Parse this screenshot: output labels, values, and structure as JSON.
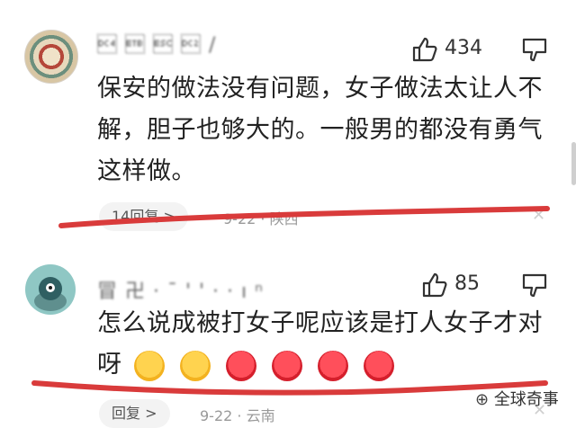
{
  "comments": [
    {
      "username": "\u0014 \u0017 \u001b \u0012 /",
      "likes": "434",
      "text_lines": [
        "保安的做法没有问题，女子做法太让人不",
        "解，胆子也够大的。一般男的都没有勇气",
        "这样做。"
      ],
      "replies": "14回复 >",
      "meta": "9-22 · 陕西"
    },
    {
      "username": "冒 卍 · ¯ ' ' ·  ·   ı ⁿ",
      "likes": "85",
      "text_lines": [
        "怎么说成被打女子呢应该是打人女子才对",
        "呀"
      ],
      "replies": "回复 >",
      "meta": "9-22 · 云南"
    }
  ],
  "emojis": [
    "blush",
    "blush",
    "angry",
    "angry",
    "angry",
    "angry"
  ],
  "watermark": "全球奇事",
  "colors": {
    "text": "#222222",
    "meta": "#999999",
    "red_line": "#d93b3b"
  }
}
